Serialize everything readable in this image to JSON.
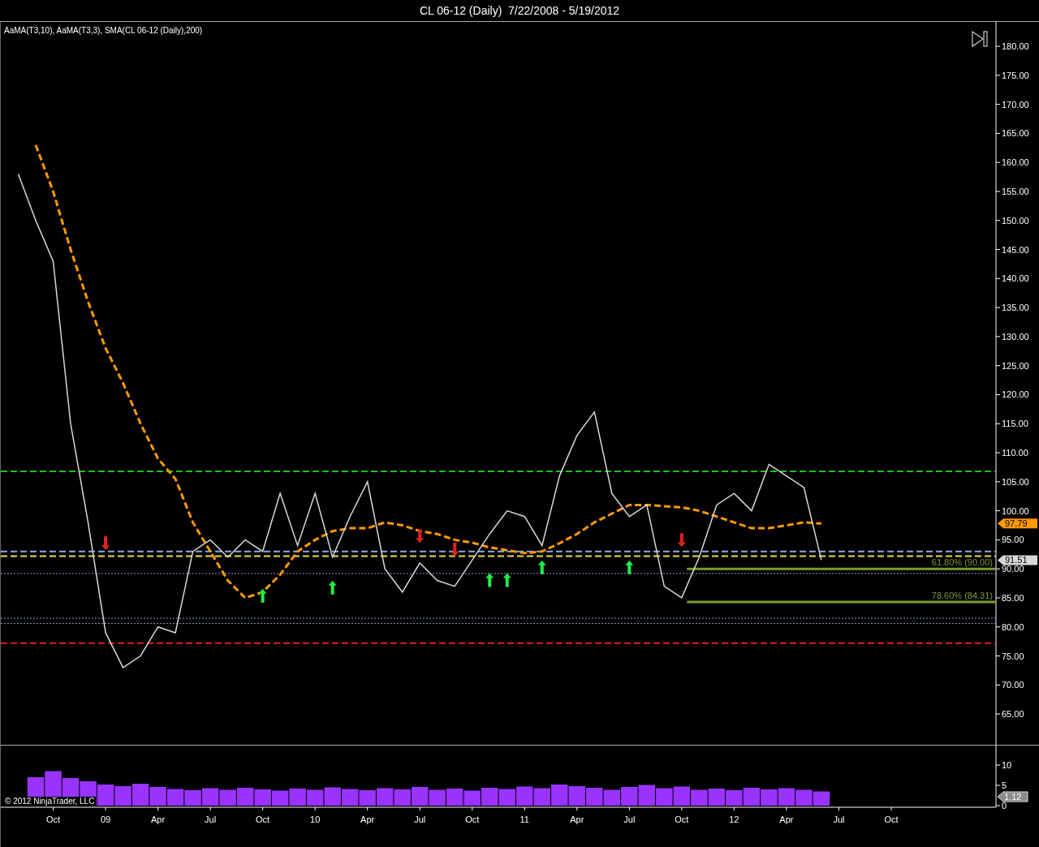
{
  "window": {
    "title": "CL 06-12 (Daily)  7/22/2008 - 5/19/2012"
  },
  "price_panel": {
    "legend": "AaMA(T3,10), AaMA(T3,3), SMA(CL 06-12 (Daily),200)",
    "chart_data": {
      "type": "line",
      "ylim": [
        59.7,
        184.2
      ],
      "series": [
        {
          "color": "#ff9900",
          "line_style": "dashed",
          "values": [
            null,
            null,
            163,
            155,
            145,
            136,
            128,
            122,
            115,
            109,
            105.5,
            98,
            93,
            88,
            85,
            86,
            89,
            93,
            95,
            96.5,
            97,
            97,
            98,
            97.5,
            96.5,
            96,
            95,
            94.5,
            93.7,
            93.2,
            92.7,
            93,
            94.4,
            96,
            98,
            99.5,
            101,
            101,
            100.8,
            100.6,
            100,
            99,
            98,
            97,
            97,
            97.5,
            98,
            97.8,
            null,
            null,
            null,
            null,
            null,
            null,
            null,
            null,
            null
          ]
        },
        {
          "color": "#d8d8d8",
          "values": [
            null,
            158,
            150,
            143,
            115,
            98,
            79,
            73,
            75,
            80,
            79,
            93,
            95,
            92,
            95,
            93,
            103,
            94,
            103,
            92,
            99,
            105,
            90,
            86,
            91,
            88,
            87,
            91.5,
            96,
            100,
            99,
            94,
            106,
            113,
            117,
            103,
            99,
            101,
            87,
            85,
            92,
            101,
            103,
            100,
            108,
            106,
            104,
            91.5,
            null,
            null,
            null,
            null,
            null,
            null,
            null,
            null,
            null
          ]
        },
        {
          "type": "scatter",
          "color": "#22ee44",
          "values": [
            null,
            null,
            null,
            null,
            null,
            null,
            null,
            null,
            null,
            null,
            null,
            null,
            null,
            null,
            null,
            85.3,
            null,
            null,
            null,
            86.7,
            null,
            null,
            null,
            null,
            null,
            null,
            null,
            null,
            88,
            88,
            null,
            90.2,
            null,
            null,
            null,
            null,
            90.2,
            null,
            null,
            null,
            null,
            null,
            null,
            null,
            null,
            null,
            null,
            null,
            null,
            null,
            null,
            null,
            null,
            null,
            null,
            null,
            null
          ]
        },
        {
          "type": "scatter",
          "color": "#e02020",
          "values": [
            null,
            null,
            null,
            null,
            null,
            null,
            94.5,
            null,
            null,
            null,
            null,
            null,
            null,
            null,
            null,
            null,
            null,
            null,
            null,
            null,
            null,
            null,
            null,
            null,
            95.7,
            null,
            93.4,
            null,
            null,
            null,
            null,
            null,
            null,
            null,
            null,
            null,
            null,
            null,
            null,
            95,
            null,
            null,
            null,
            null,
            null,
            null,
            null,
            null,
            null,
            null,
            null,
            null,
            null,
            null,
            null,
            null,
            null
          ]
        }
      ],
      "yticks": [
        {
          "value": 180,
          "label": "180.00"
        },
        {
          "value": 175,
          "label": "175.00"
        },
        {
          "value": 170,
          "label": "170.00"
        },
        {
          "value": 165,
          "label": "165.00"
        },
        {
          "value": 160,
          "label": "160.00"
        },
        {
          "value": 155,
          "label": "155.00"
        },
        {
          "value": 150,
          "label": "150.00"
        },
        {
          "value": 145,
          "label": "145.00"
        },
        {
          "value": 140,
          "label": "140.00"
        },
        {
          "value": 135,
          "label": "135.00"
        },
        {
          "value": 130,
          "label": "130.00"
        },
        {
          "value": 125,
          "label": "125.00"
        },
        {
          "value": 120,
          "label": "120.00"
        },
        {
          "value": 115,
          "label": "115.00"
        },
        {
          "value": 110,
          "label": "110.00"
        },
        {
          "value": 105,
          "label": "105.00"
        },
        {
          "value": 100,
          "label": "100.00"
        },
        {
          "value": 95,
          "label": "95.00"
        },
        {
          "value": 90,
          "label": "90.00"
        },
        {
          "value": 85,
          "label": "85.00"
        },
        {
          "value": 80,
          "label": "80.00"
        },
        {
          "value": 75,
          "label": "75.00"
        },
        {
          "value": 70,
          "label": "70.00"
        },
        {
          "value": 65,
          "label": "65.00"
        }
      ],
      "ref_lines": [
        {
          "axis": "y",
          "value": 106.8,
          "color": "#22c022",
          "line_style": "dashed"
        },
        {
          "axis": "y",
          "value": 93,
          "color": "#88aadd",
          "line_style": "dashed"
        },
        {
          "axis": "y",
          "value": 92.2,
          "color": "#e8e040",
          "line_style": "dashed"
        },
        {
          "axis": "y",
          "value": 89.2,
          "color": "#8899cc",
          "line_style": "dotted"
        },
        {
          "axis": "y",
          "value": 81.5,
          "color": "#8899cc",
          "line_style": "dotted"
        },
        {
          "axis": "y",
          "value": 80.6,
          "color": "#8899cc",
          "line_style": "dotted"
        },
        {
          "axis": "y",
          "value": 77.2,
          "color": "#e02020",
          "line_style": "dashed"
        },
        {
          "axis": "y",
          "value": 90,
          "label": "61.80% (90.00)",
          "color": "#7a9a30",
          "line_style": "solid"
        },
        {
          "axis": "y",
          "value": 84.31,
          "label": "78.60% (84.31)",
          "color": "#7a9a30",
          "line_style": "solid"
        }
      ],
      "annotations": [
        "97.79",
        "91.51"
      ]
    }
  },
  "volume_panel": {
    "chart_data": {
      "type": "bar",
      "ylim": [
        0,
        14.8
      ],
      "categories": [
        null,
        null,
        null,
        "Oct",
        null,
        null,
        "09",
        null,
        null,
        "Apr",
        null,
        null,
        "Jul",
        null,
        null,
        "Oct",
        null,
        null,
        "10",
        null,
        null,
        "Apr",
        null,
        null,
        "Jul",
        null,
        null,
        "Oct",
        null,
        null,
        "11",
        null,
        null,
        "Apr",
        null,
        null,
        "Jul",
        null,
        null,
        "Oct",
        null,
        null,
        "12",
        null,
        null,
        "Apr",
        null,
        null,
        "Jul",
        null,
        null,
        "Oct",
        null,
        null,
        null,
        null,
        null
      ],
      "series": [
        {
          "color": "#9933ff",
          "values": [
            null,
            null,
            7,
            8.5,
            6.8,
            6,
            5.2,
            4.8,
            5.4,
            4.6,
            4.1,
            3.8,
            4.3,
            3.9,
            4.4,
            4,
            3.7,
            4.2,
            3.9,
            4.5,
            4.1,
            3.8,
            4.3,
            4,
            4.6,
            3.9,
            4.2,
            3.7,
            4.4,
            4.1,
            4.7,
            4.3,
            5.2,
            4.8,
            4.4,
            3.9,
            4.6,
            5.1,
            4.3,
            4.7,
            3.9,
            4.2,
            3.8,
            4.4,
            4,
            4.3,
            3.9,
            3.5,
            null,
            null,
            null,
            null,
            null,
            null,
            null,
            null,
            null
          ]
        }
      ],
      "yticks": [
        0,
        5,
        10
      ],
      "annotations": [
        "1.12"
      ]
    }
  },
  "copyright": "© 2012 NinjaTrader, LLC"
}
